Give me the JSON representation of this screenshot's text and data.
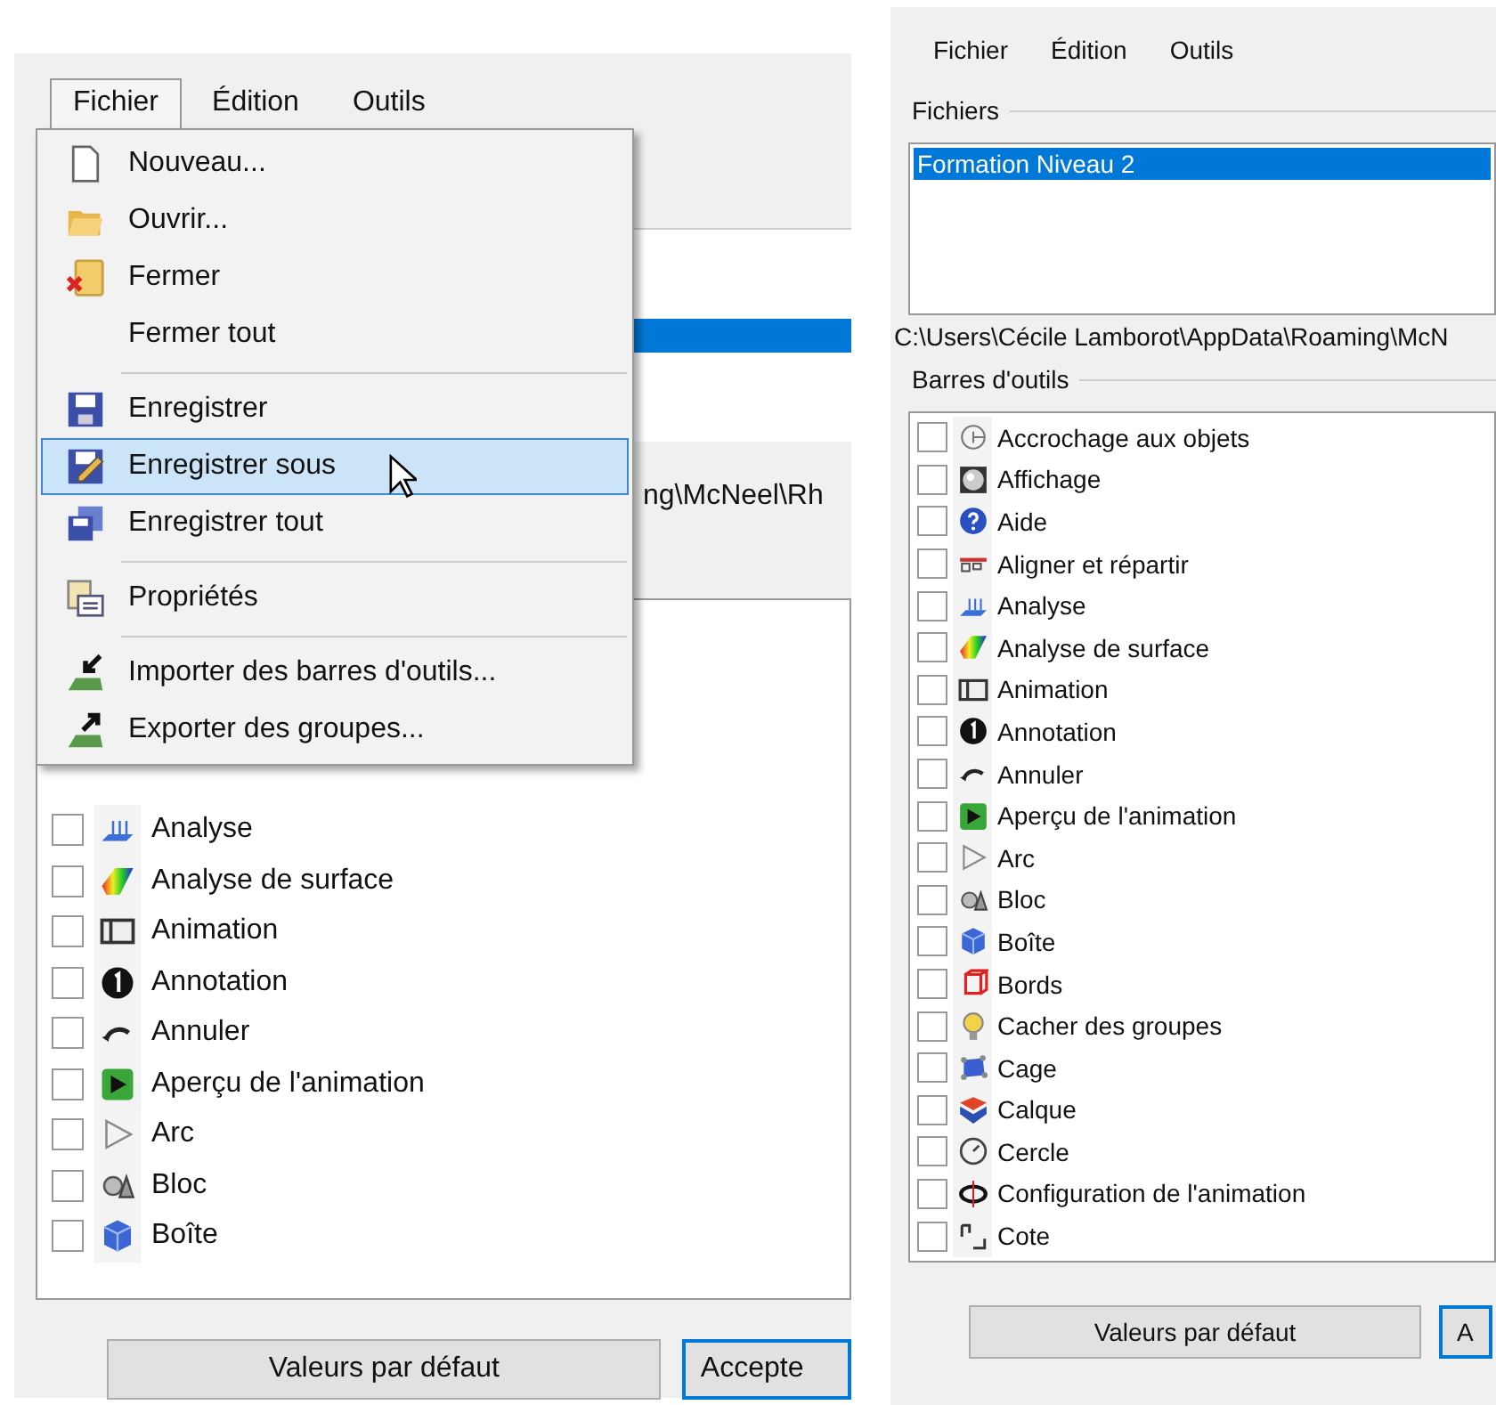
{
  "left_window": {
    "menu_bar": [
      {
        "label": "Fichier",
        "selected": true
      },
      {
        "label": "Édition",
        "selected": false
      },
      {
        "label": "Outils",
        "selected": false
      }
    ],
    "file_menu": [
      {
        "label": "Nouveau...",
        "selected": false,
        "separator_before": false
      },
      {
        "label": "Ouvrir...",
        "selected": false,
        "separator_before": false
      },
      {
        "label": "Fermer",
        "selected": false,
        "separator_before": false
      },
      {
        "label": "Fermer tout",
        "selected": false,
        "separator_before": false
      },
      {
        "label": "Enregistrer",
        "selected": false,
        "separator_before": true
      },
      {
        "label": "Enregistrer sous",
        "selected": true,
        "separator_before": false
      },
      {
        "label": "Enregistrer tout",
        "selected": false,
        "separator_before": false
      },
      {
        "label": "Propriétés",
        "selected": false,
        "separator_before": true
      },
      {
        "label": "Importer des barres d'outils...",
        "selected": false,
        "separator_before": true
      },
      {
        "label": "Exporter des groupes...",
        "selected": false,
        "separator_before": false
      }
    ],
    "files_list": [
      {
        "selected": true
      }
    ],
    "path": "ng\\McNeel\\Rh",
    "toolbars": [
      {
        "label": "Analyse",
        "checked": false
      },
      {
        "label": "Analyse de surface",
        "checked": false
      },
      {
        "label": "Animation",
        "checked": false
      },
      {
        "label": "Annotation",
        "checked": false
      },
      {
        "label": "Annuler",
        "checked": false
      },
      {
        "label": "Aperçu de l'animation",
        "checked": false
      },
      {
        "label": "Arc",
        "checked": false
      },
      {
        "label": "Bloc",
        "checked": false
      },
      {
        "label": "Boîte",
        "checked": false
      }
    ],
    "buttons": [
      {
        "label": "Valeurs par défaut",
        "default": false
      },
      {
        "label": "Accepte",
        "default": true
      }
    ]
  },
  "right_window": {
    "menu_bar": [
      {
        "label": "Fichier",
        "selected": false
      },
      {
        "label": "Édition",
        "selected": false
      },
      {
        "label": "Outils",
        "selected": false
      }
    ],
    "files_group": "Fichiers",
    "files_list": [
      {
        "label": "Formation Niveau 2",
        "selected": true
      }
    ],
    "path": "C:\\Users\\Cécile Lamborot\\AppData\\Roaming\\McN",
    "toolbars_group": "Barres d'outils",
    "toolbars": [
      {
        "label": "Accrochage aux objets",
        "checked": false
      },
      {
        "label": "Affichage",
        "checked": false
      },
      {
        "label": "Aide",
        "checked": false
      },
      {
        "label": "Aligner et répartir",
        "checked": false
      },
      {
        "label": "Analyse",
        "checked": false
      },
      {
        "label": "Analyse de surface",
        "checked": false
      },
      {
        "label": "Animation",
        "checked": false
      },
      {
        "label": "Annotation",
        "checked": false
      },
      {
        "label": "Annuler",
        "checked": false
      },
      {
        "label": "Aperçu de l'animation",
        "checked": false
      },
      {
        "label": "Arc",
        "checked": false
      },
      {
        "label": "Bloc",
        "checked": false
      },
      {
        "label": "Boîte",
        "checked": false
      },
      {
        "label": "Bords",
        "checked": false
      },
      {
        "label": "Cacher des groupes",
        "checked": false
      },
      {
        "label": "Cage",
        "checked": false
      },
      {
        "label": "Calque",
        "checked": false
      },
      {
        "label": "Cercle",
        "checked": false
      },
      {
        "label": "Configuration de l'animation",
        "checked": false
      },
      {
        "label": "Cote",
        "checked": false
      }
    ],
    "buttons": [
      {
        "label": "Valeurs par défaut",
        "default": false
      },
      {
        "label": "A",
        "default": true
      }
    ]
  }
}
